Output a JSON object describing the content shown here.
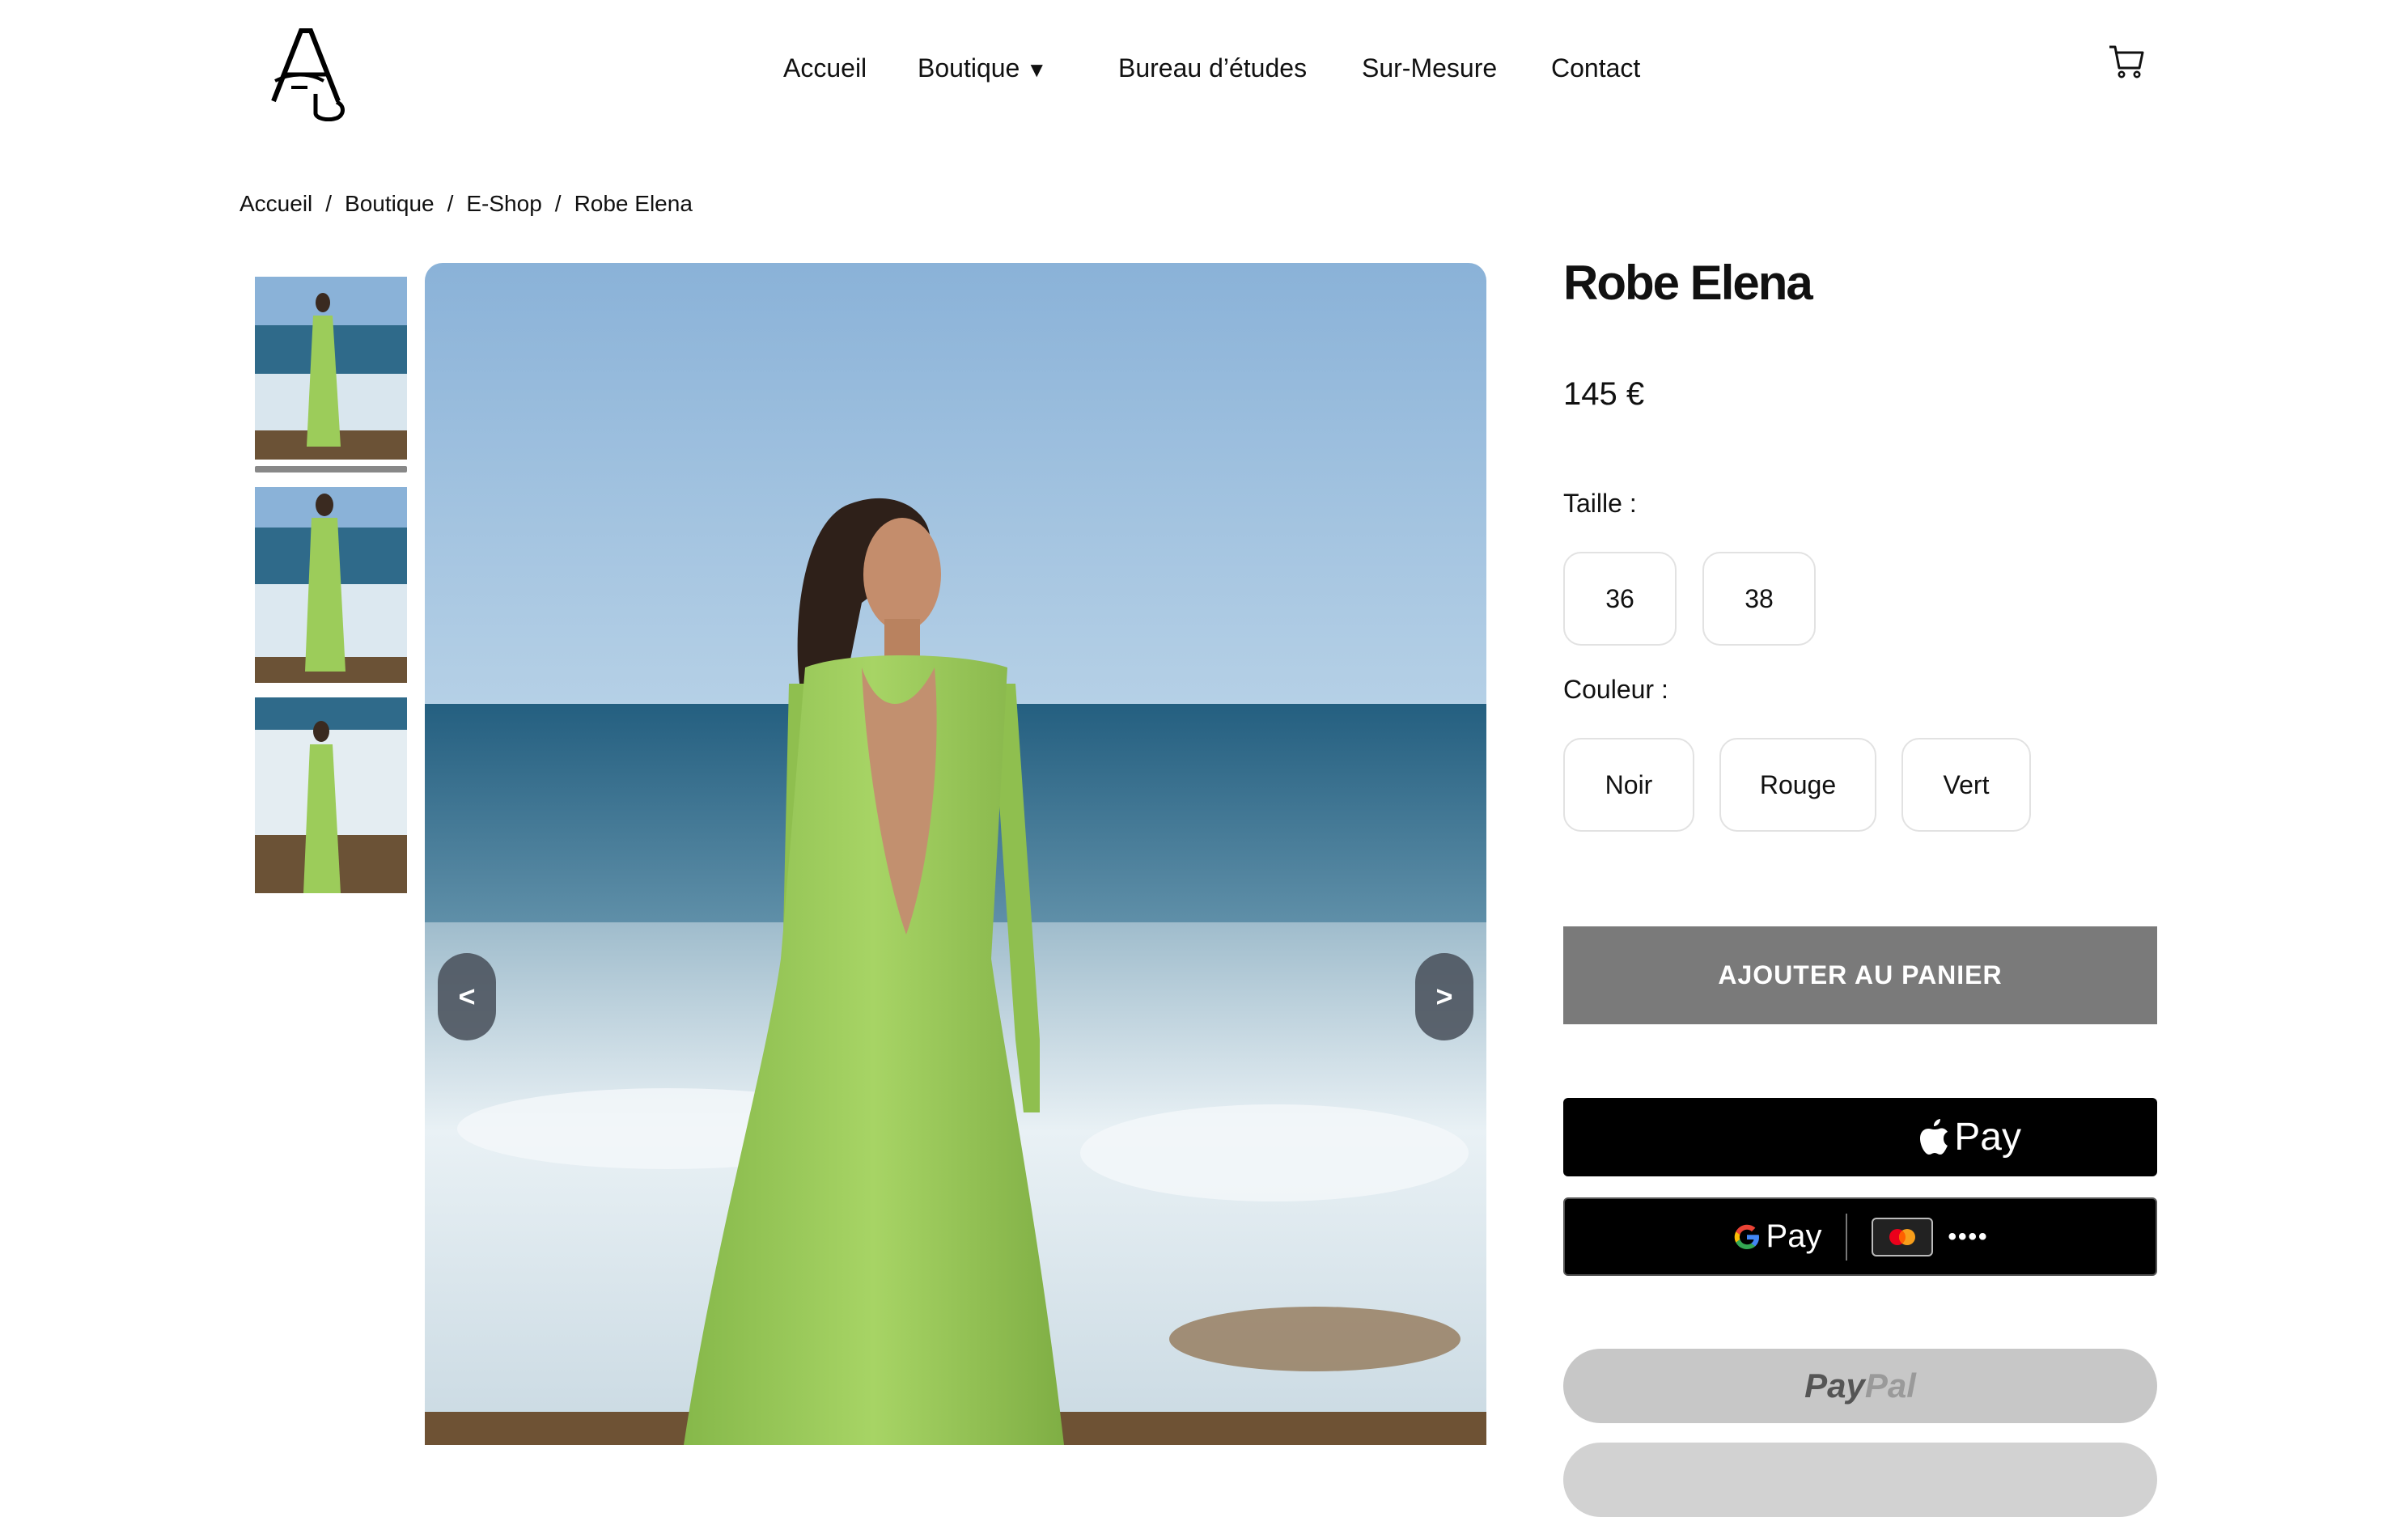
{
  "header": {
    "logo_alt": "AS",
    "nav": [
      {
        "label": "Accueil"
      },
      {
        "label": "Boutique",
        "caret": "▼"
      },
      {
        "label": "Bureau d’études"
      },
      {
        "label": "Sur-Mesure"
      },
      {
        "label": "Contact"
      }
    ],
    "cart_icon": "cart-icon"
  },
  "breadcrumb": {
    "items": [
      "Accueil",
      "Boutique",
      "E-Shop",
      "Robe Elena"
    ],
    "separator": "/"
  },
  "gallery": {
    "prev_label": "<",
    "next_label": ">",
    "active_thumbnail": 1,
    "thumbnail_count": 3
  },
  "product": {
    "title": "Robe Elena",
    "price": "145 €",
    "size_label": "Taille :",
    "sizes": [
      "36",
      "38"
    ],
    "color_label": "Couleur :",
    "colors": [
      "Noir",
      "Rouge",
      "Vert"
    ],
    "add_to_cart": "AJOUTER AU PANIER"
  },
  "payment": {
    "apple_pay": "Pay",
    "google_pay": "Pay",
    "google_pay_card_dots": "••••",
    "paypal_part1": "Pay",
    "paypal_part2": "Pal"
  },
  "colors": {
    "add_to_cart_bg": "#7a7a7a",
    "dress_green": "#9ccc5a",
    "sky": "#8ab2d8",
    "sea": "#2f6a8a"
  }
}
